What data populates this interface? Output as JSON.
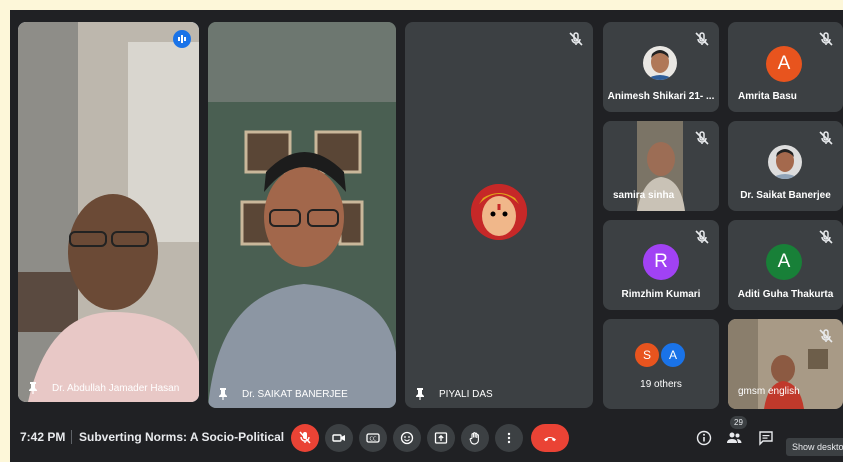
{
  "participants": {
    "main": [
      {
        "name": "Dr. Abdullah Jamader Hasan"
      },
      {
        "name": "Dr. SAIKAT BANERJEE"
      },
      {
        "name": "PIYALI DAS"
      }
    ],
    "small": [
      {
        "name": "Animesh Shikari 21- ..."
      },
      {
        "name": "Amrita Basu",
        "initial": "A",
        "color": "#e8541e"
      },
      {
        "name": "samira sinha"
      },
      {
        "name": "Dr. Saikat Banerjee"
      },
      {
        "name": "Rimzhim Kumari",
        "initial": "R",
        "color": "#a142f4"
      },
      {
        "name": "Aditi Guha Thakurta",
        "initial": "A",
        "color": "#188038"
      },
      {
        "name": "19 others",
        "initials": [
          "S",
          "A"
        ],
        "colors": [
          "#e8541e",
          "#1a73e8"
        ]
      },
      {
        "name": "gmsm english"
      }
    ]
  },
  "bottom_bar": {
    "time": "7:42 PM",
    "meeting_title": "Subverting Norms: A Socio-Political Ex...",
    "people_count": "29",
    "tooltip": "Show deskto"
  },
  "colors": {
    "end_call": "#ea4335",
    "mic_off": "#ea4335",
    "active_border": "#8ab4f8"
  }
}
